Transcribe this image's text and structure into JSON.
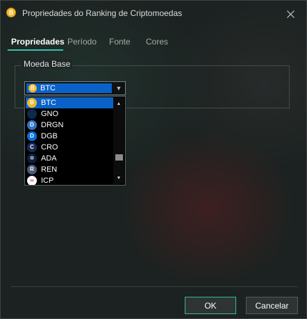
{
  "window": {
    "title": "Propriedades do Ranking de Criptomoedas",
    "app_icon": "bitcoin-app-icon",
    "app_icon_glyph": "B"
  },
  "tabs": [
    {
      "label": "Propriedades",
      "active": true
    },
    {
      "label": "Período",
      "active": false
    },
    {
      "label": "Fonte",
      "active": false
    },
    {
      "label": "Cores",
      "active": false
    }
  ],
  "group": {
    "label": "Moeda Base"
  },
  "combo": {
    "selected": "BTC",
    "selected_icon": "bitcoin-icon"
  },
  "dropdown": {
    "items": [
      {
        "label": "BTC",
        "icon": "bitcoin-icon",
        "color": "#f3b72a",
        "glyph": "B",
        "selected": true
      },
      {
        "label": "GNO",
        "icon": "gnosis-icon",
        "color": "#0d2a4a",
        "glyph": "",
        "selected": false
      },
      {
        "label": "DRGN",
        "icon": "dragonchain-icon",
        "color": "#2f75c9",
        "glyph": "D",
        "selected": false
      },
      {
        "label": "DGB",
        "icon": "digibyte-icon",
        "color": "#0a6fd8",
        "glyph": "D",
        "selected": false
      },
      {
        "label": "CRO",
        "icon": "cronos-icon",
        "color": "#1a2a56",
        "glyph": "C",
        "selected": false
      },
      {
        "label": "ADA",
        "icon": "cardano-icon",
        "color": "#0b1f40",
        "glyph": "✲",
        "selected": false
      },
      {
        "label": "REN",
        "icon": "ren-icon",
        "color": "#465a78",
        "glyph": "R",
        "selected": false
      },
      {
        "label": "ICP",
        "icon": "internet-computer-icon",
        "color": "#ffffff",
        "glyph": "∞",
        "selected": false
      }
    ],
    "scroll_position": 0.78
  },
  "buttons": {
    "ok": "OK",
    "cancel": "Cancelar"
  },
  "colors": {
    "accent": "#39c0a8",
    "selection": "#0a62c9",
    "background": "#1c2221"
  }
}
